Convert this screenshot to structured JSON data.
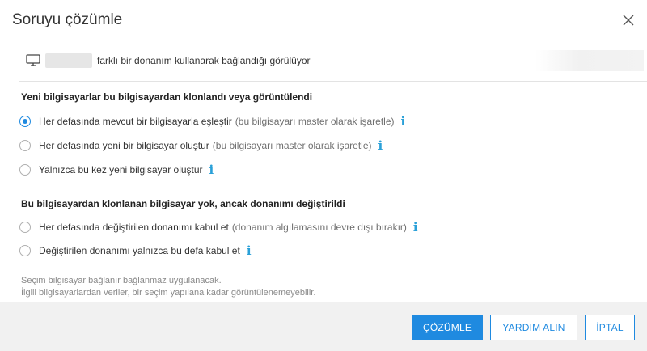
{
  "dialog": {
    "title": "Soruyu çözümle",
    "device_message": "farklı bir donanım kullanarak bağlandığı görülüyor"
  },
  "section1": {
    "heading": "Yeni bilgisayarlar bu bilgisayardan klonlandı veya görüntülendi",
    "options": [
      {
        "label": "Her defasında mevcut bir bilgisayarla eşleştir",
        "hint": "(bu bilgisayarı master olarak işaretle)",
        "selected": true
      },
      {
        "label": "Her defasında yeni bir bilgisayar oluştur",
        "hint": "(bu bilgisayarı master olarak işaretle)",
        "selected": false
      },
      {
        "label": "Yalnızca bu kez yeni bilgisayar oluştur",
        "hint": "",
        "selected": false
      }
    ]
  },
  "section2": {
    "heading": "Bu bilgisayardan klonlanan bilgisayar yok, ancak donanımı değiştirildi",
    "options": [
      {
        "label": "Her defasında değiştirilen donanımı kabul et",
        "hint": "(donanım algılamasını devre dışı bırakır)",
        "selected": false
      },
      {
        "label": "Değiştirilen donanımı yalnızca bu defa kabul et",
        "hint": "",
        "selected": false
      }
    ]
  },
  "notes": {
    "line1": "Seçim bilgisayar bağlanır bağlanmaz uygulanacak.",
    "line2": "İlgili bilgisayarlardan veriler, bir seçim yapılana kadar görüntülenemeyebilir."
  },
  "buttons": {
    "resolve": "ÇÖZÜMLE",
    "help": "YARDIM ALIN",
    "cancel": "İPTAL"
  },
  "info_glyph": "i",
  "colors": {
    "accent": "#1f8ae0",
    "info": "#2aa0d8"
  }
}
